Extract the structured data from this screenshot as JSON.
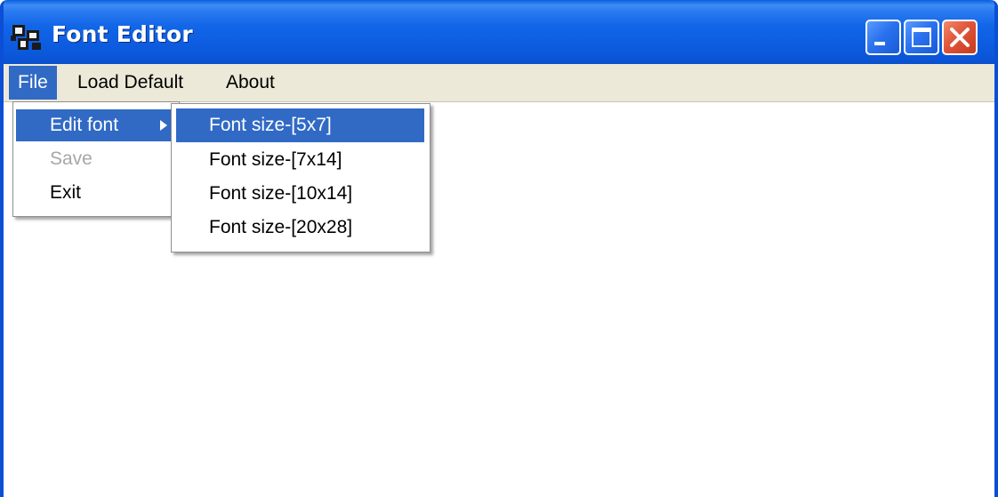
{
  "window": {
    "title": "Font Editor",
    "app_icon": "font-editor-app-icon",
    "controls": {
      "minimize_icon": "minimize-icon",
      "maximize_icon": "maximize-icon",
      "close_icon": "close-icon"
    },
    "colors": {
      "titlebar": "#0a5fe0",
      "selection": "#316ac5",
      "close_button": "#e0553a",
      "disabled_text": "#a7a7a7"
    }
  },
  "menubar": {
    "items": [
      {
        "label": "File",
        "open": true
      },
      {
        "label": "Load Default"
      },
      {
        "label": "About"
      }
    ]
  },
  "file_menu": {
    "items": [
      {
        "label": "Edit font",
        "has_submenu": true,
        "highlighted": true
      },
      {
        "label": "Save",
        "disabled": true
      },
      {
        "label": "Exit"
      }
    ]
  },
  "edit_font_submenu": {
    "items": [
      {
        "label": "Font size-[5x7]",
        "highlighted": true
      },
      {
        "label": "Font size-[7x14]"
      },
      {
        "label": "Font size-[10x14]"
      },
      {
        "label": "Font size-[20x28]"
      }
    ]
  }
}
